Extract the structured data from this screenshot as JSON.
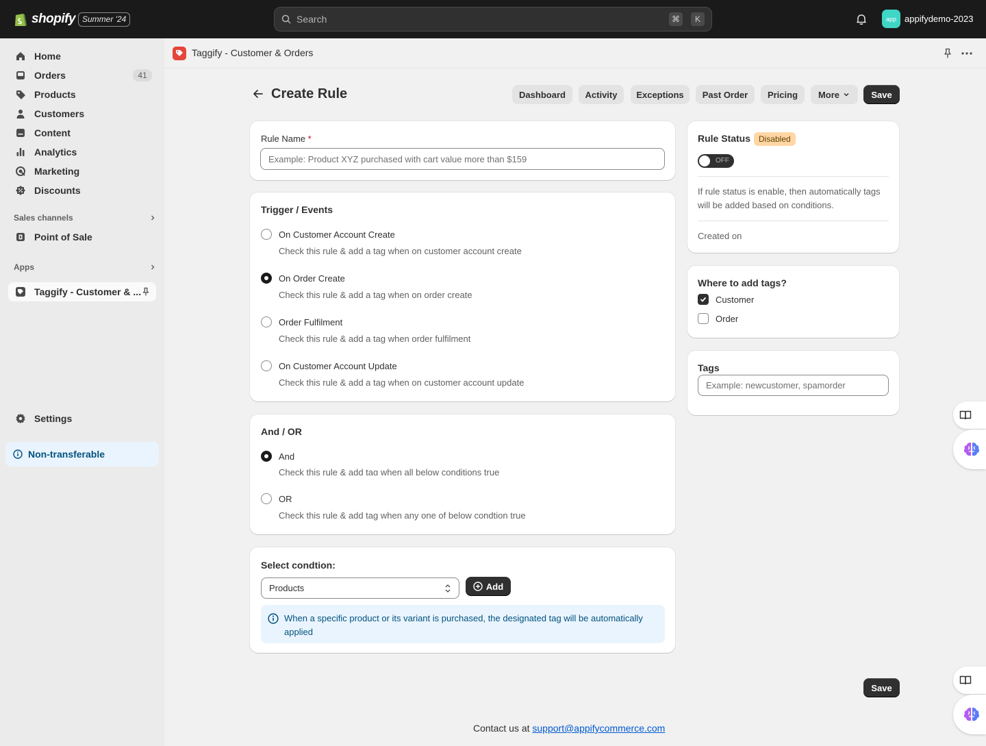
{
  "topbar": {
    "logo_text": "shopify",
    "edition": "Summer '24",
    "search_placeholder": "Search",
    "shortcut_key1": "⌘",
    "shortcut_key2": "K",
    "store_avatar": "app",
    "store_name": "appifydemo-2023"
  },
  "sidebar": {
    "items": [
      {
        "label": "Home",
        "icon": "home-icon"
      },
      {
        "label": "Orders",
        "icon": "orders-icon",
        "badge": "41"
      },
      {
        "label": "Products",
        "icon": "tag-icon"
      },
      {
        "label": "Customers",
        "icon": "person-icon"
      },
      {
        "label": "Content",
        "icon": "content-icon"
      },
      {
        "label": "Analytics",
        "icon": "bar-chart-icon"
      },
      {
        "label": "Marketing",
        "icon": "target-icon"
      },
      {
        "label": "Discounts",
        "icon": "discount-icon"
      }
    ],
    "sales_channels_label": "Sales channels",
    "point_of_sale_label": "Point of Sale",
    "apps_label": "Apps",
    "active_app_label": "Taggify - Customer & ...",
    "settings_label": "Settings",
    "non_transferable_label": "Non-transferable"
  },
  "app_header": {
    "title": "Taggify - Customer & Orders"
  },
  "page": {
    "title": "Create Rule",
    "tabs": {
      "dashboard": "Dashboard",
      "activity": "Activity",
      "exceptions": "Exceptions",
      "past_order": "Past Order",
      "pricing": "Pricing",
      "more": "More"
    },
    "save_label": "Save"
  },
  "rule_name": {
    "label": "Rule Name",
    "required_mark": "*",
    "placeholder": "Example: Product XYZ purchased with cart value more than $159"
  },
  "trigger": {
    "title": "Trigger / Events",
    "options": [
      {
        "label": "On Customer Account Create",
        "desc": "Check this rule & add a tag when on customer account create",
        "selected": false
      },
      {
        "label": "On Order Create",
        "desc": "Check this rule & add a tag when on order create",
        "selected": true
      },
      {
        "label": "Order Fulfilment",
        "desc": "Check this rule & add a tag when order fulfilment",
        "selected": false
      },
      {
        "label": "On Customer Account Update",
        "desc": "Check this rule & add a tag when on customer account update",
        "selected": false
      }
    ]
  },
  "and_or": {
    "title": "And / OR",
    "options": [
      {
        "label": "And",
        "desc": "Check this rule & add tag when all below conditions true",
        "selected": true
      },
      {
        "label": "OR",
        "desc": "Check this rule & add tag when any one of below condtion true",
        "selected": false
      }
    ]
  },
  "condition": {
    "title": "Select condtion:",
    "selected": "Products",
    "add_label": "Add",
    "info": "When a specific product or its variant is purchased, the designated tag will be automatically applied"
  },
  "rule_status": {
    "title": "Rule Status",
    "badge": "Disabled",
    "toggle_text": "OFF",
    "help": "If rule status is enable, then automatically tags will be added based on conditions.",
    "created_on": "Created on"
  },
  "where_tags": {
    "title": "Where to add tags?",
    "options": [
      {
        "label": "Customer",
        "checked": true
      },
      {
        "label": "Order",
        "checked": false
      }
    ]
  },
  "tags": {
    "title": "Tags",
    "placeholder": "Example: newcustomer, spamorder"
  },
  "footer": {
    "contact_prefix": "Contact us at",
    "email": "support@appifycommerce.com"
  },
  "colors": {
    "topbar": "#1a1a1a",
    "primary_button": "#303030",
    "disabled_badge": "#ffd6a4",
    "info_banner": "#eaf4ff",
    "app_icon": "#e5453a"
  }
}
